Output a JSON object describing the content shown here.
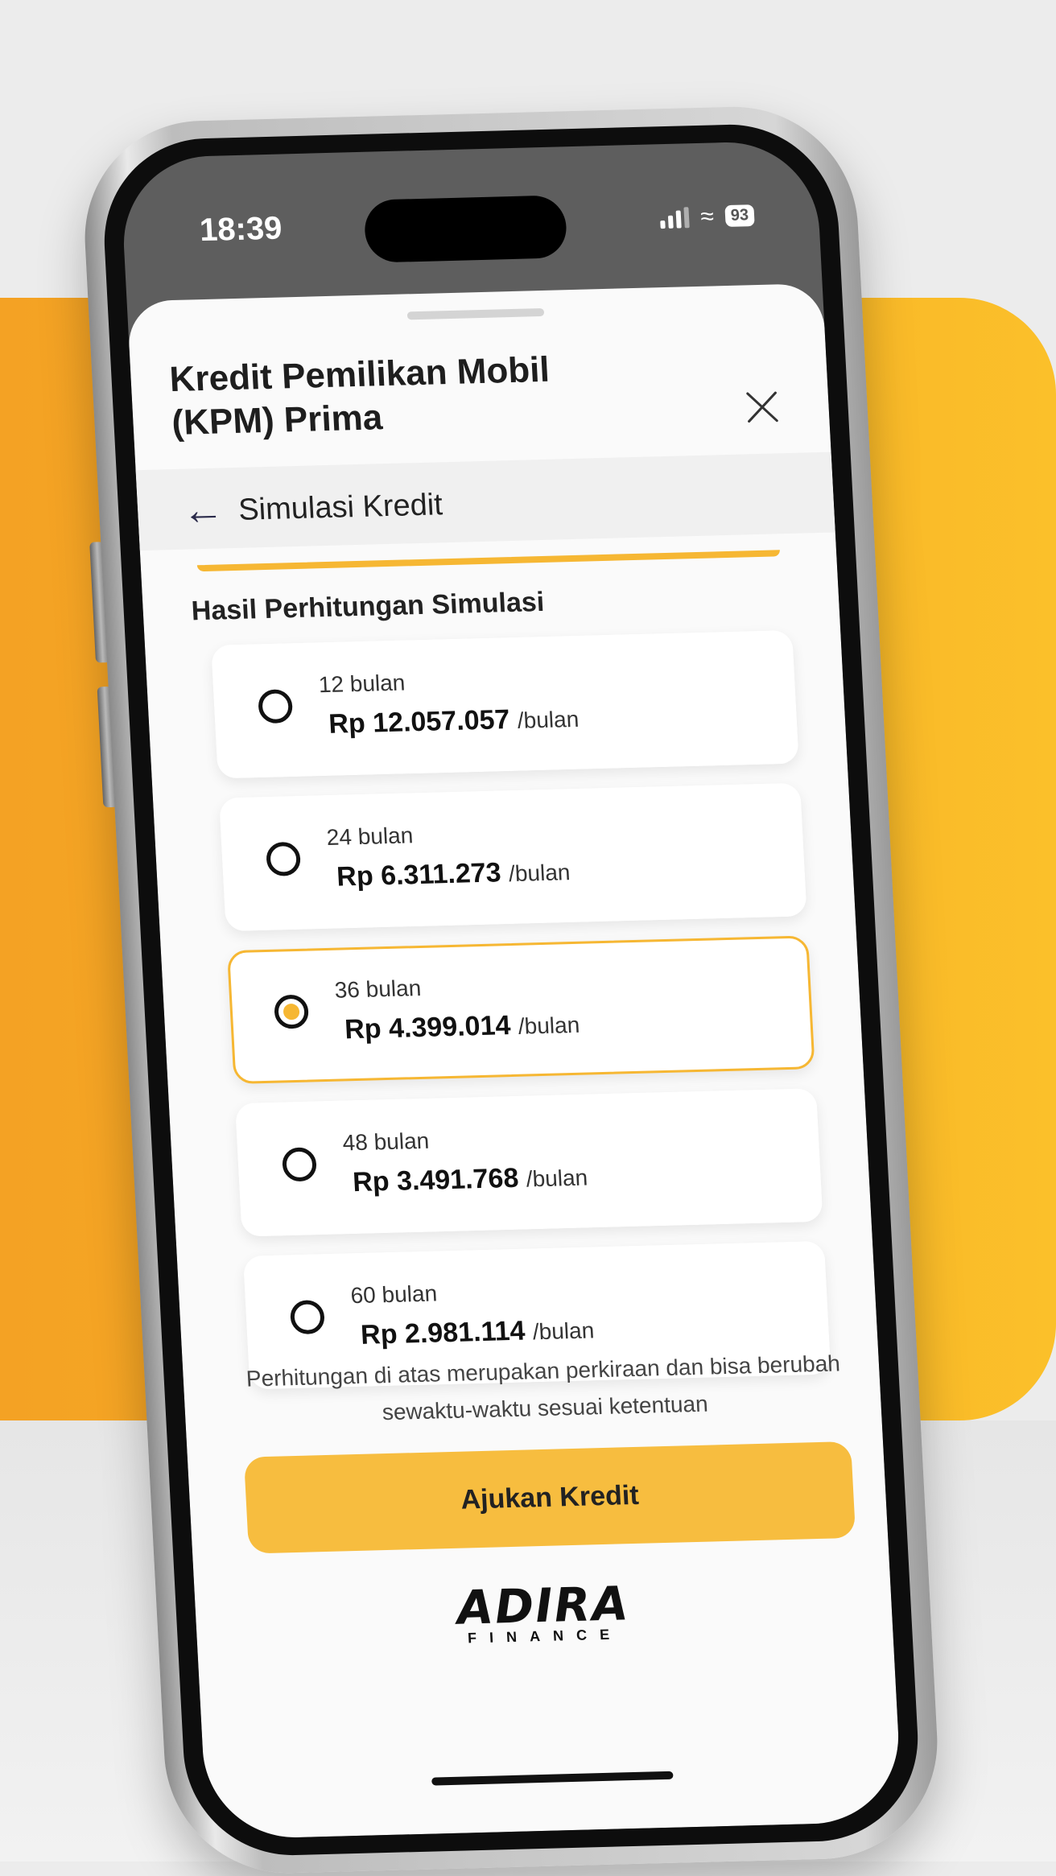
{
  "status_bar": {
    "time": "18:39",
    "battery": "93",
    "wifi_icon": "wifi-icon",
    "signal_icon": "signal-icon"
  },
  "sheet": {
    "title": "Kredit Pemilikan Mobil (KPM) Prima",
    "close_icon": "close-icon"
  },
  "subheader": {
    "back_icon": "arrow-left-icon",
    "title": "Simulasi Kredit"
  },
  "section_title": "Hasil Perhitungan Simulasi",
  "options": [
    {
      "term": "12 bulan",
      "amount": "Rp 12.057.057",
      "unit": "/bulan",
      "selected": false
    },
    {
      "term": "24 bulan",
      "amount": "Rp 6.311.273",
      "unit": "/bulan",
      "selected": false
    },
    {
      "term": "36 bulan",
      "amount": "Rp 4.399.014",
      "unit": "/bulan",
      "selected": true
    },
    {
      "term": "48 bulan",
      "amount": "Rp 3.491.768",
      "unit": "/bulan",
      "selected": false
    },
    {
      "term": "60 bulan",
      "amount": "Rp 2.981.114",
      "unit": "/bulan",
      "selected": false
    }
  ],
  "disclaimer": "Perhitungan di atas merupakan perkiraan dan bisa berubah sewaktu-waktu sesuai ketentuan",
  "cta_label": "Ajukan Kredit",
  "logo": {
    "name": "ADIRA",
    "sub": "FINANCE"
  },
  "colors": {
    "accent": "#f6b733",
    "background_band": "#f7ab24"
  }
}
